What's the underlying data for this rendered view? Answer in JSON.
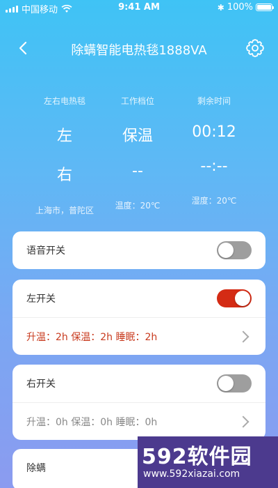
{
  "status_bar": {
    "carrier": "中国移动",
    "time": "9:41 AM",
    "battery": "100%"
  },
  "nav": {
    "title": "除螨智能电热毯1888VA"
  },
  "info": {
    "columns": [
      {
        "header": "左右电热毯",
        "row1": "左",
        "row2": "右",
        "footer": "上海市，普陀区"
      },
      {
        "header": "工作档位",
        "row1": "保温",
        "row2": "--",
        "footer": "温度：20℃"
      },
      {
        "header": "剩余时间",
        "row1": "00:12",
        "row2": "--:--",
        "footer": "湿度：20℃"
      }
    ]
  },
  "voice_card": {
    "label": "语音开关",
    "toggle": "off"
  },
  "left_card": {
    "label": "左开关",
    "toggle": "on",
    "summary": "升温：2h  保温：2h  睡眠：2h"
  },
  "right_card": {
    "label": "右开关",
    "toggle": "off",
    "summary": "升温：0h  保温：0h  睡眠：0h"
  },
  "mite_card": {
    "label": "除螨"
  },
  "watermark": {
    "title": "592软件园",
    "url": "www.592xiazai.com"
  },
  "colors": {
    "accent_on": "#d42b14",
    "toggle_off": "#9e9e9e",
    "summary_on": "#c83a1e"
  }
}
